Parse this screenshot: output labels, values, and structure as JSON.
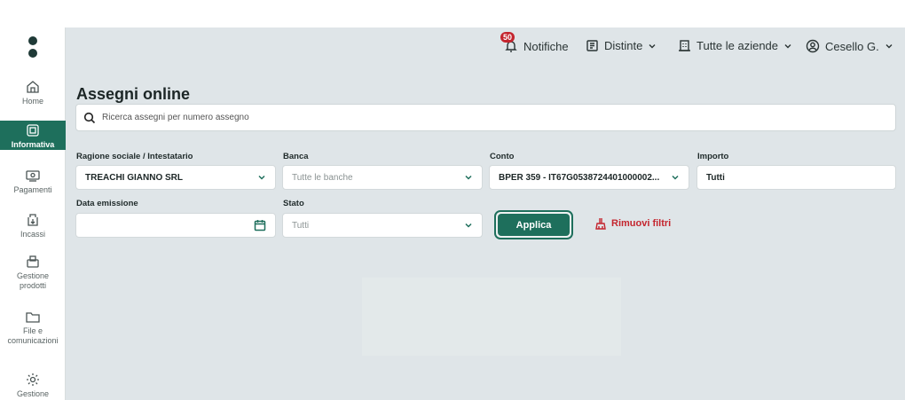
{
  "sidebar": {
    "items": [
      {
        "label": "Home",
        "icon": "home-icon"
      },
      {
        "label": "Informativa",
        "icon": "info-card-icon",
        "active": true
      },
      {
        "label": "Pagamenti",
        "icon": "payments-icon"
      },
      {
        "label": "Incassi",
        "icon": "collections-icon"
      },
      {
        "label": "Gestione prodotti",
        "icon": "products-icon"
      },
      {
        "label": "File e comunicazioni",
        "icon": "folder-icon"
      },
      {
        "label": "Gestione",
        "icon": "settings-icon"
      }
    ]
  },
  "topbar": {
    "notifications_label": "Notifiche",
    "notifications_count": "50",
    "distinte_label": "Distinte",
    "companies_label": "Tutte le aziende",
    "user_label": "Cesello G."
  },
  "page": {
    "title": "Assegni online",
    "search_placeholder": "Ricerca assegni per numero assegno"
  },
  "filters": {
    "ragione_label": "Ragione sociale / Intestatario",
    "ragione_value": "TREACHI GIANNO SRL",
    "banca_label": "Banca",
    "banca_value": "Tutte le banche",
    "conto_label": "Conto",
    "conto_value": "BPER 359 - IT67G0538724401000002...",
    "importo_label": "Importo",
    "importo_value": "Tutti",
    "data_label": "Data emissione",
    "data_value": "",
    "stato_label": "Stato",
    "stato_value": "Tutti"
  },
  "actions": {
    "apply_label": "Applica",
    "remove_label": "Rimuovi filtri"
  },
  "colors": {
    "accent": "#1e6f5c",
    "danger": "#c4252e",
    "background": "#dfe5e8"
  }
}
